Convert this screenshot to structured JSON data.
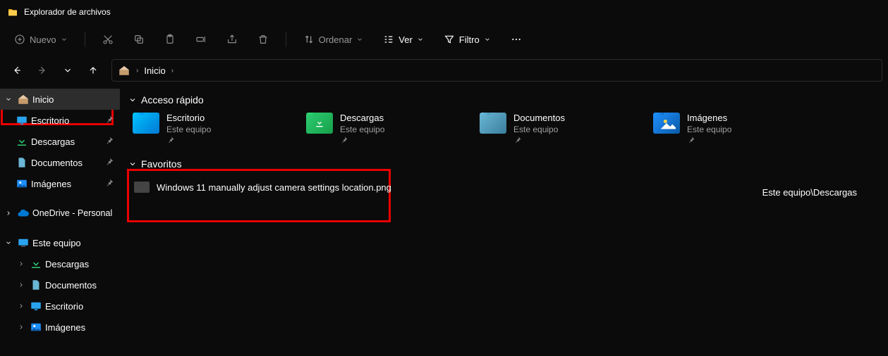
{
  "app": {
    "title": "Explorador de archivos"
  },
  "toolbar": {
    "new_label": "Nuevo",
    "sort_label": "Ordenar",
    "view_label": "Ver",
    "filter_label": "Filtro"
  },
  "breadcrumb": {
    "root": "Inicio"
  },
  "sidebar": {
    "home": "Inicio",
    "escritorio": "Escritorio",
    "descargas": "Descargas",
    "documentos": "Documentos",
    "imagenes": "Imágenes",
    "onedrive": "OneDrive - Personal",
    "este_equipo": "Este equipo",
    "pc_descargas": "Descargas",
    "pc_documentos": "Documentos",
    "pc_escritorio": "Escritorio",
    "pc_imagenes": "Imágenes"
  },
  "sections": {
    "quick_access": "Acceso rápido",
    "favorites": "Favoritos"
  },
  "quick_access": [
    {
      "name": "Escritorio",
      "sub": "Este equipo",
      "color": "linear-gradient(135deg,#00c3ff,#0078d4)"
    },
    {
      "name": "Descargas",
      "sub": "Este equipo",
      "color": "linear-gradient(135deg,#2ecc71,#16a04a)"
    },
    {
      "name": "Documentos",
      "sub": "Este equipo",
      "color": "linear-gradient(135deg,#6ab7d6,#3a7e9c)"
    },
    {
      "name": "Imágenes",
      "sub": "Este equipo",
      "color": "linear-gradient(135deg,#1e90ff,#0b5aa6)"
    }
  ],
  "favorites": {
    "file": "Windows 11 manually adjust camera settings location.png",
    "path": "Este equipo\\Descargas"
  }
}
